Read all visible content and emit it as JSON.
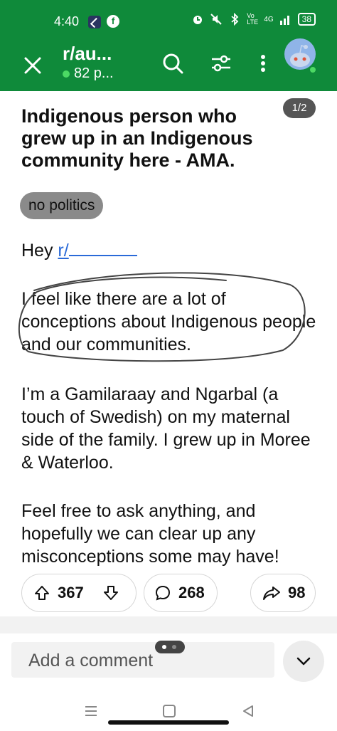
{
  "status_bar": {
    "time": "4:40",
    "network_label": "4G",
    "volte_label": "Vo LTE",
    "battery": "38"
  },
  "header": {
    "subreddit": "r/au...",
    "online_count": "82 p...",
    "online_color": "#4cd964",
    "bar_color": "#0f8a3a"
  },
  "post": {
    "title": "Indigenous person who grew up in an Indigenous community here - AMA.",
    "page_indicator": "1/2",
    "flair": "no politics",
    "greeting": "Hey",
    "mention_partial": "r/",
    "paragraph1": "I feel like there are a lot of conceptions about Indigenous people and our communities.",
    "paragraph2": "I’m a Gamilaraay and Ngarbal (a touch of Swedish) on my maternal side of the family. I grew up in Moree & Waterloo.",
    "paragraph3": "Feel free to ask anything, and hopefully we can clear up any misconceptions some may have!"
  },
  "actions": {
    "upvotes": "367",
    "comments": "268",
    "shares": "98"
  },
  "comment_bar": {
    "placeholder": "Add a comment"
  }
}
